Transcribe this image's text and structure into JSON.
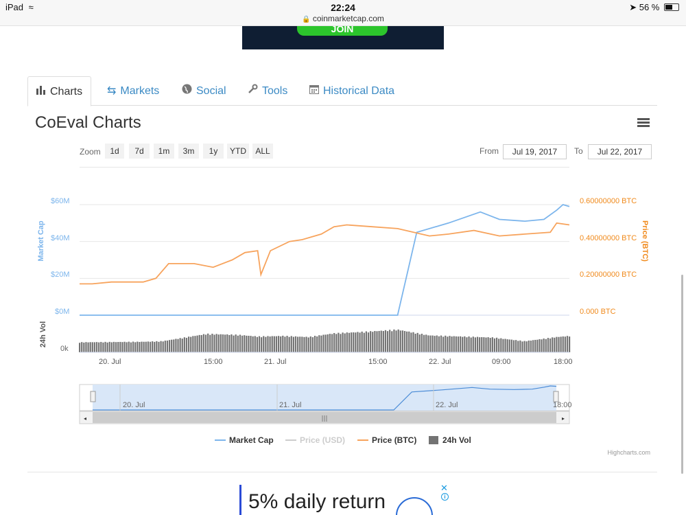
{
  "status_bar": {
    "device": "iPad",
    "time": "22:24",
    "url": "coinmarketcap.com",
    "battery": "56 %",
    "battery_level": 0.56
  },
  "ad_top": {
    "button": "JOIN"
  },
  "tabs": [
    {
      "label": "Charts",
      "icon": "bar-chart-icon",
      "active": true
    },
    {
      "label": "Markets",
      "icon": "exchange-icon",
      "active": false
    },
    {
      "label": "Social",
      "icon": "globe-icon",
      "active": false
    },
    {
      "label": "Tools",
      "icon": "wrench-icon",
      "active": false
    },
    {
      "label": "Historical Data",
      "icon": "calendar-icon",
      "active": false
    }
  ],
  "page_title": "CoEval Charts",
  "zoom": {
    "label": "Zoom",
    "options": [
      "1d",
      "7d",
      "1m",
      "3m",
      "1y",
      "YTD",
      "ALL"
    ]
  },
  "range": {
    "from_label": "From",
    "from_value": "Jul 19, 2017",
    "to_label": "To",
    "to_value": "Jul 22, 2017"
  },
  "credits": "Highcharts.com",
  "ad_bottom": {
    "text": "5% daily return",
    "close": "✕",
    "info": "i"
  },
  "colors": {
    "market_cap": "#7cb5ec",
    "price_btc": "#f7a35c",
    "volume": "#737373",
    "price_usd_disabled": "#cccccc",
    "link": "#3b8ac4",
    "navigator_fill": "#d9e7f8"
  },
  "chart_data": {
    "type": "line",
    "x_ticks": [
      "20. Jul",
      "15:00",
      "21. Jul",
      "15:00",
      "22. Jul",
      "09:00",
      "18:00"
    ],
    "y_left": {
      "label": "Market Cap",
      "ticks": [
        "$0M",
        "$20M",
        "$40M",
        "$60M"
      ],
      "ylim": [
        0,
        60
      ]
    },
    "y_right": {
      "label": "Price (BTC)",
      "ticks": [
        "0.000 BTC",
        "0.20000000 BTC",
        "0.40000000 BTC",
        "0.60000000 BTC"
      ],
      "ylim": [
        0,
        0.6
      ]
    },
    "volume_axis": {
      "label": "24h Vol",
      "ticks": [
        "0k"
      ]
    },
    "x_hours": [
      0,
      5,
      10,
      15,
      20,
      25,
      30,
      35,
      40,
      45,
      50,
      55,
      60,
      65,
      70,
      75
    ],
    "series": [
      {
        "name": "Market Cap",
        "unit": "$M",
        "x": [
          0,
          10,
          20,
          30,
          32,
          32.2,
          34,
          36,
          38,
          40,
          44,
          50,
          53,
          58,
          63,
          66,
          70,
          73,
          75,
          76,
          77
        ],
        "values": [
          0,
          0,
          0,
          0,
          0,
          0,
          0,
          0,
          0,
          0,
          0,
          0,
          45,
          50,
          56,
          52,
          51,
          52,
          57,
          60,
          59
        ]
      },
      {
        "name": "Price (BTC)",
        "unit": "BTC",
        "x": [
          0,
          2,
          5,
          10,
          12,
          14,
          18,
          21,
          24,
          26,
          28,
          28.5,
          30,
          33,
          35,
          38,
          40,
          42,
          46,
          50,
          55,
          58,
          62,
          66,
          70,
          74,
          75,
          77
        ],
        "values": [
          0.17,
          0.17,
          0.18,
          0.18,
          0.2,
          0.28,
          0.28,
          0.26,
          0.3,
          0.34,
          0.35,
          0.22,
          0.35,
          0.4,
          0.41,
          0.44,
          0.48,
          0.49,
          0.48,
          0.47,
          0.43,
          0.44,
          0.46,
          0.43,
          0.44,
          0.45,
          0.5,
          0.49
        ]
      },
      {
        "name": "24h Vol",
        "unit": "relative",
        "x": [
          0,
          10,
          13,
          20,
          25,
          28,
          32,
          36,
          40,
          45,
          50,
          55,
          60,
          65,
          70,
          75,
          77
        ],
        "values": [
          0.38,
          0.4,
          0.42,
          0.7,
          0.66,
          0.6,
          0.62,
          0.58,
          0.72,
          0.78,
          0.86,
          0.64,
          0.6,
          0.56,
          0.42,
          0.58,
          0.62
        ]
      }
    ],
    "legend": [
      {
        "name": "Market Cap",
        "enabled": true
      },
      {
        "name": "Price (USD)",
        "enabled": false
      },
      {
        "name": "Price (BTC)",
        "enabled": true
      },
      {
        "name": "24h Vol",
        "enabled": true
      }
    ],
    "legend_position": "bottom-center",
    "navigator_ticks": [
      "20. Jul",
      "21. Jul",
      "22. Jul",
      "18:00"
    ],
    "grid": true
  }
}
